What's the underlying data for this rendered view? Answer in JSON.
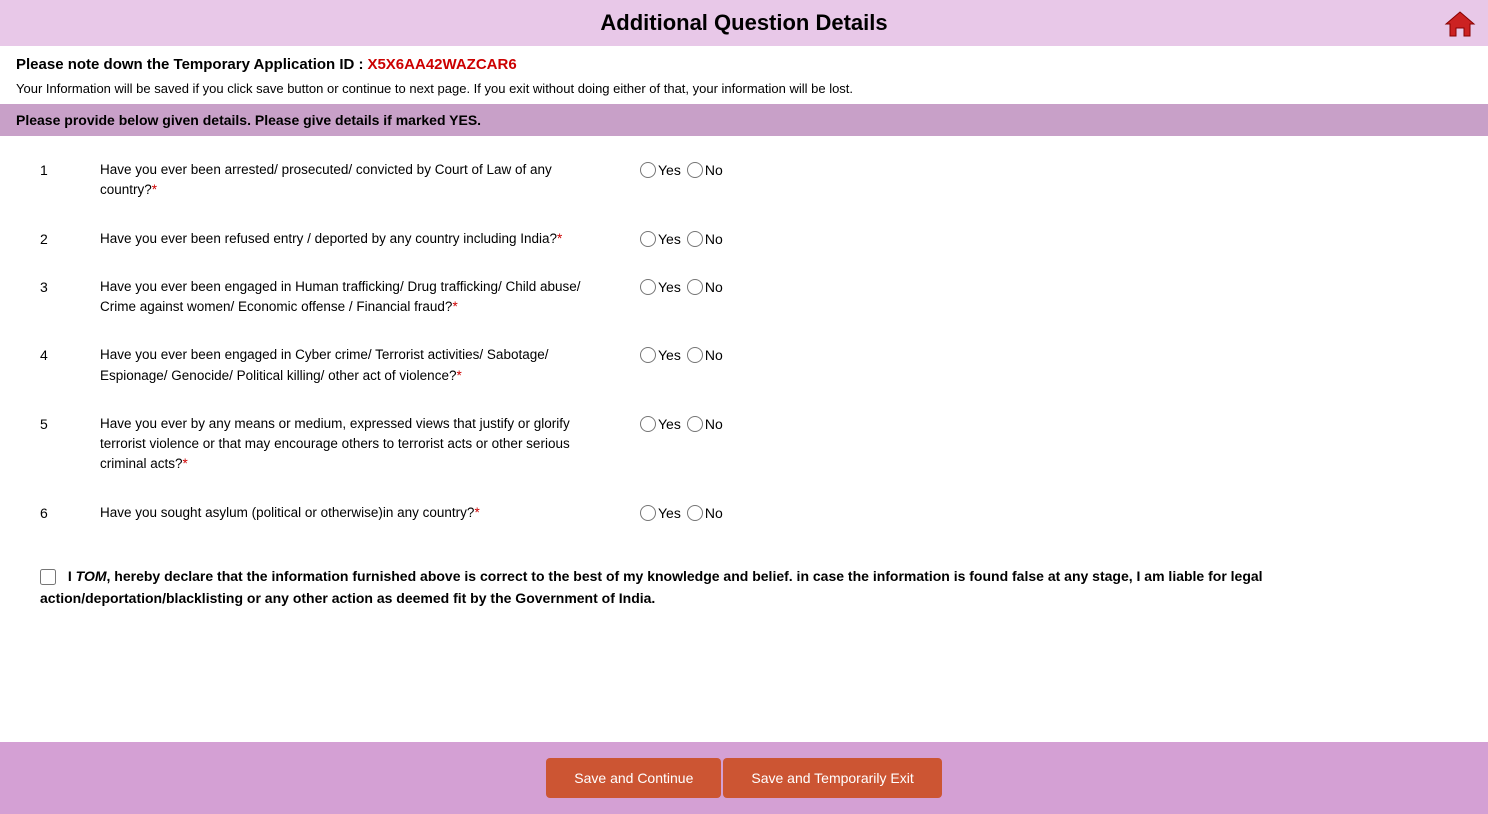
{
  "header": {
    "title": "Additional Question Details",
    "home_icon_label": "Home"
  },
  "app_id": {
    "label": "Please note down the Temporary Application ID :",
    "value": "X5X6AA42WAZCAR6"
  },
  "info_text": "Your Information will be saved if you click save button or continue to next page. If you exit without doing either of that, your information will be lost.",
  "section_banner": "Please provide below given details. Please give details if marked YES.",
  "questions": [
    {
      "number": "1",
      "text": "Have you ever been arrested/ prosecuted/ convicted by Court of Law of any country?",
      "required": true
    },
    {
      "number": "2",
      "text": "Have you ever been refused entry / deported by any country including India?",
      "required": true
    },
    {
      "number": "3",
      "text": "Have you ever been engaged in Human trafficking/ Drug trafficking/ Child abuse/ Crime against women/ Economic offense / Financial fraud?",
      "required": true
    },
    {
      "number": "4",
      "text": "Have you ever been engaged in Cyber crime/ Terrorist activities/ Sabotage/ Espionage/ Genocide/ Political killing/ other act of violence?",
      "required": true
    },
    {
      "number": "5",
      "text": "Have you ever by any means or medium, expressed views that justify or glorify terrorist violence or that may encourage others to terrorist acts or other serious criminal acts?",
      "required": true
    },
    {
      "number": "6",
      "text": "Have you sought asylum (political or otherwise)in any country?",
      "required": true
    }
  ],
  "radio_options": {
    "yes_label": "Yes",
    "no_label": "No"
  },
  "declaration": {
    "name": "TOM",
    "text_before": "I ",
    "text_after": ", hereby declare that the information furnished above is correct to the best of my knowledge and belief. in case the information is found false at any stage, I am liable for legal action/deportation/blacklisting or any other action as deemed fit by the Government of India."
  },
  "buttons": {
    "save_continue": "Save and Continue",
    "save_exit": "Save and Temporarily Exit"
  }
}
